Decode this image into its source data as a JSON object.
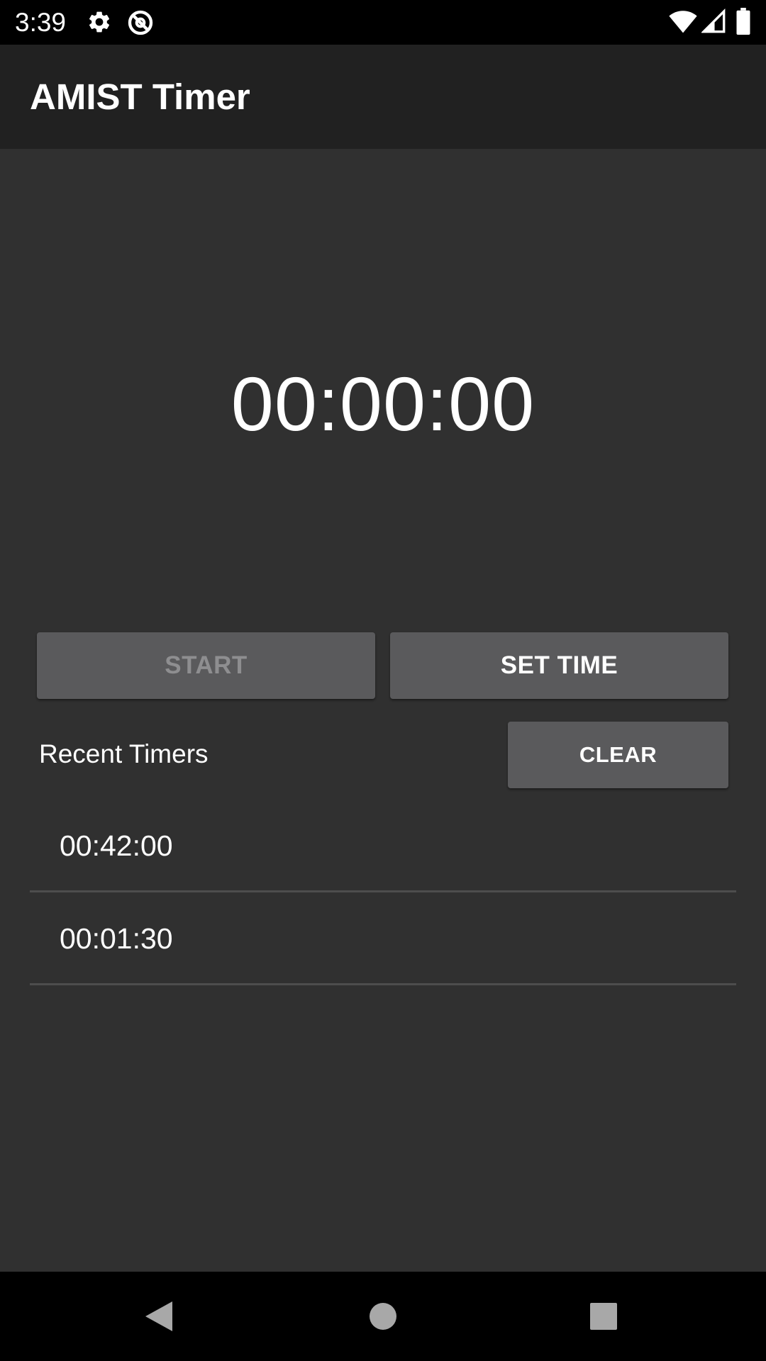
{
  "status_bar": {
    "time": "3:39",
    "icons": [
      "gear-icon",
      "sync-disabled-icon",
      "wifi-icon",
      "signal-icon",
      "battery-icon"
    ]
  },
  "app_bar": {
    "title": "AMIST Timer"
  },
  "timer": {
    "display": "00:00:00"
  },
  "controls": {
    "start_label": "START",
    "start_enabled": false,
    "set_time_label": "SET TIME",
    "clear_label": "CLEAR"
  },
  "recent": {
    "label": "Recent Timers",
    "items": [
      {
        "time": "00:42:00"
      },
      {
        "time": "00:01:30"
      }
    ]
  },
  "nav_bar": {
    "icons": [
      "back-icon",
      "home-icon",
      "recents-icon"
    ]
  },
  "colors": {
    "background": "#303030",
    "app_bar": "#212121",
    "button": "#5a5a5c",
    "disabled_text": "#8e8e90",
    "divider": "#4d4d4d"
  }
}
